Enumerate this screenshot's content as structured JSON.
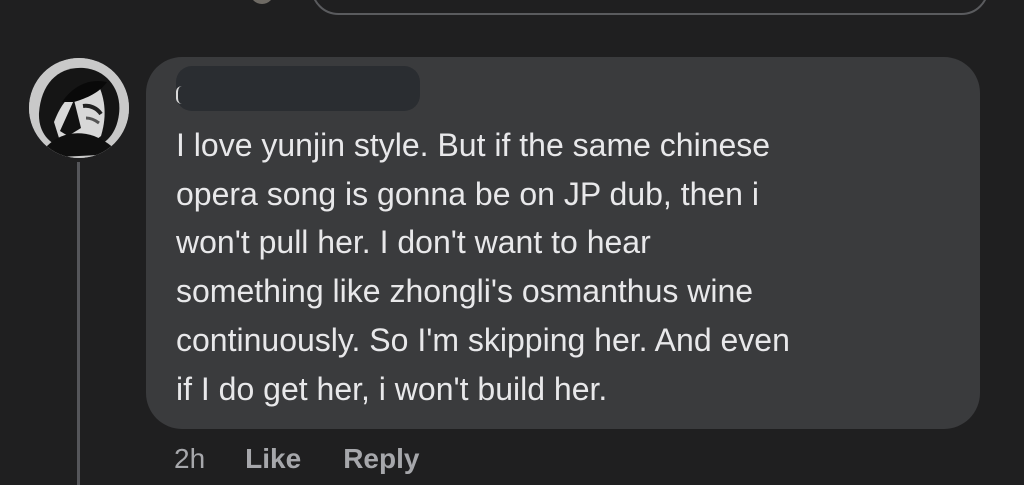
{
  "comment": {
    "text": "I love yunjin style. But if the same chinese\nopera song is gonna be on JP dub, then i\nwon't pull her. I don't want to hear\nsomething like zhongli's osmanthus wine\ncontinuously. So I'm skipping her. And even\nif I do get her, i won't build her.",
    "time": "2h",
    "like_label": "Like",
    "reply_label": "Reply"
  },
  "icons": {
    "avatar": "anime-avatar-icon"
  },
  "colors": {
    "background": "#1f1f20",
    "bubble": "#3a3b3d",
    "text": "#e8e8ea",
    "meta": "#a6a7ab"
  }
}
